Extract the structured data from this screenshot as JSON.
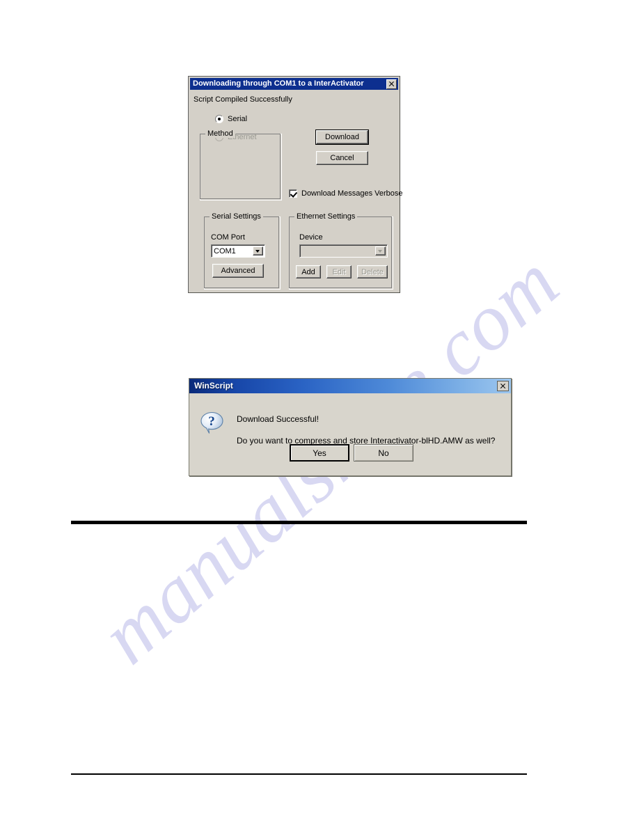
{
  "page": {
    "watermark": "manualshive.com"
  },
  "download_dialog": {
    "title": "Downloading through COM1 to a InterActivator",
    "close_icon": "close-icon",
    "status": "Script Compiled Successfully",
    "method_group": {
      "label": "Method",
      "options": [
        {
          "label": "Serial",
          "selected": true,
          "enabled": true
        },
        {
          "label": "Ethernet",
          "selected": false,
          "enabled": false
        }
      ]
    },
    "buttons": {
      "download": "Download",
      "cancel": "Cancel"
    },
    "verbose_checkbox": {
      "label": "Download Messages Verbose",
      "checked": true
    },
    "serial_settings": {
      "label": "Serial Settings",
      "com_port_label": "COM Port",
      "com_port_value": "COM1",
      "advanced_button": "Advanced"
    },
    "ethernet_settings": {
      "label": "Ethernet Settings",
      "device_label": "Device",
      "device_value": "",
      "add_button": "Add",
      "edit_button": "Edit",
      "delete_button": "Delete"
    }
  },
  "winscript_dialog": {
    "title": "WinScript",
    "close_icon": "close-icon",
    "icon": "question-balloon-icon",
    "message_line_1": "Download Successful!",
    "message_line_2": "Do you want to compress and store Interactivator-blHD.AMW as well?",
    "buttons": {
      "yes": "Yes",
      "no": "No"
    }
  },
  "colors": {
    "dialog_face": "#d4d0c8",
    "classic_titlebar": "#0d2f8f",
    "xp_titlebar_start": "#0a2a7a",
    "xp_titlebar_end": "#9cc6ef",
    "watermark": "#b9b9e8",
    "rule": "#000000"
  }
}
